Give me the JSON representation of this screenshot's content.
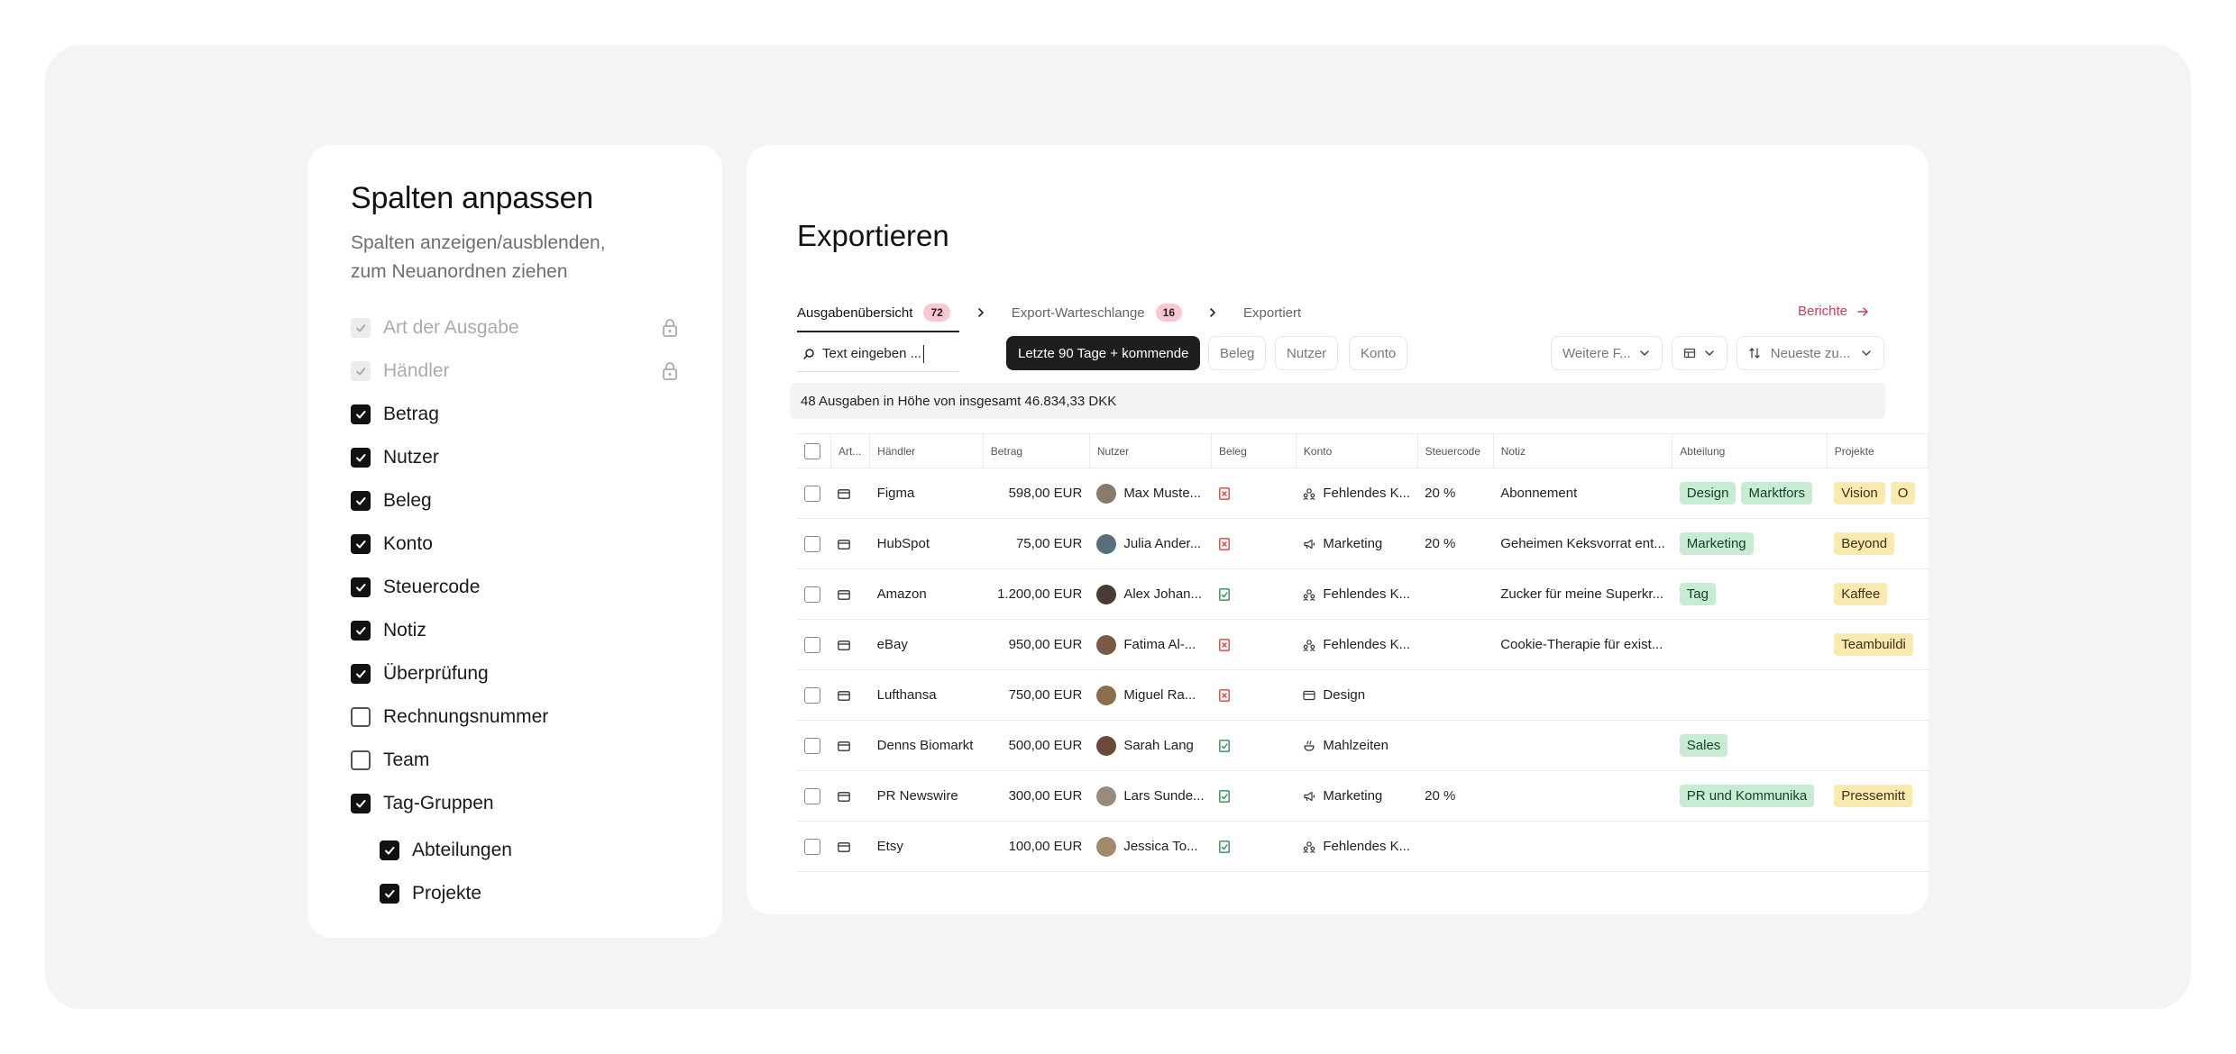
{
  "columns_panel": {
    "title": "Spalten anpassen",
    "subtitle": "Spalten anzeigen/ausblenden, zum Neuanordnen ziehen",
    "items": [
      {
        "label": "Art der Ausgabe",
        "state": "locked"
      },
      {
        "label": "Händler",
        "state": "locked"
      },
      {
        "label": "Betrag",
        "state": "checked"
      },
      {
        "label": "Nutzer",
        "state": "checked"
      },
      {
        "label": "Beleg",
        "state": "checked"
      },
      {
        "label": "Konto",
        "state": "checked"
      },
      {
        "label": "Steuercode",
        "state": "checked"
      },
      {
        "label": "Notiz",
        "state": "checked"
      },
      {
        "label": "Überprüfung",
        "state": "checked"
      },
      {
        "label": "Rechnungsnummer",
        "state": "unchecked"
      },
      {
        "label": "Team",
        "state": "unchecked"
      },
      {
        "label": "Tag-Gruppen",
        "state": "checked"
      }
    ],
    "subitems": [
      {
        "label": "Abteilungen",
        "state": "checked"
      },
      {
        "label": "Projekte",
        "state": "checked"
      }
    ]
  },
  "export": {
    "title": "Exportieren",
    "steps": [
      {
        "label": "Ausgabenübersicht",
        "count": "72"
      },
      {
        "label": "Export-Warteschlange",
        "count": "16"
      },
      {
        "label": "Exportiert"
      }
    ],
    "reports_link": "Berichte",
    "search_value": "Text eingeben ...",
    "filters": {
      "date": "Letzte 90 Tage + kommende",
      "beleg": "Beleg",
      "nutzer": "Nutzer",
      "konto": "Konto",
      "more": "Weitere F...",
      "sort": "Neueste zu..."
    },
    "summary": "48 Ausgaben in Höhe von insgesamt 46.834,33 DKK",
    "headers": {
      "art": "Art...",
      "haendler": "Händler",
      "betrag": "Betrag",
      "nutzer": "Nutzer",
      "beleg": "Beleg",
      "konto": "Konto",
      "steuercode": "Steuercode",
      "notiz": "Notiz",
      "abteilung": "Abteilung",
      "projekte": "Projekte"
    },
    "rows": [
      {
        "haendler": "Figma",
        "betrag": "598,00 EUR",
        "nutzer": "Max Muste...",
        "beleg": "missing",
        "konto_icon": "people-icon",
        "konto": "Fehlendes K...",
        "steuer": "20 %",
        "notiz": "Abonnement",
        "abteilung": [
          "Design",
          "Marktfors"
        ],
        "projekte": [
          "Vision",
          "O"
        ]
      },
      {
        "haendler": "HubSpot",
        "betrag": "75,00 EUR",
        "nutzer": "Julia Ander...",
        "beleg": "missing",
        "konto_icon": "megaphone-icon",
        "konto": "Marketing",
        "steuer": "20 %",
        "notiz": "Geheimen Keksvorrat ent...",
        "abteilung": [
          "Marketing"
        ],
        "projekte": [
          "Beyond"
        ]
      },
      {
        "haendler": "Amazon",
        "betrag": "1.200,00 EUR",
        "nutzer": "Alex Johan...",
        "beleg": "ok",
        "konto_icon": "people-icon",
        "konto": "Fehlendes K...",
        "steuer": "",
        "notiz": "Zucker für meine Superkr...",
        "abteilung": [
          "Tag"
        ],
        "projekte": [
          "Kaffee"
        ]
      },
      {
        "haendler": "eBay",
        "betrag": "950,00 EUR",
        "nutzer": "Fatima Al-...",
        "beleg": "missing",
        "konto_icon": "people-icon",
        "konto": "Fehlendes K...",
        "steuer": "",
        "notiz": "Cookie-Therapie für exist...",
        "abteilung": [],
        "projekte": [
          "Teambuildi"
        ]
      },
      {
        "haendler": "Lufthansa",
        "betrag": "750,00 EUR",
        "nutzer": "Miguel Ra...",
        "beleg": "missing",
        "konto_icon": "card-icon",
        "konto": "Design",
        "steuer": "",
        "notiz": "",
        "abteilung": [],
        "projekte": []
      },
      {
        "haendler": "Denns Biomarkt",
        "betrag": "500,00 EUR",
        "nutzer": "Sarah Lang",
        "beleg": "ok",
        "konto_icon": "food-icon",
        "konto": "Mahlzeiten",
        "steuer": "",
        "notiz": "",
        "abteilung": [
          "Sales"
        ],
        "projekte": []
      },
      {
        "haendler": "PR Newswire",
        "betrag": "300,00 EUR",
        "nutzer": "Lars Sunde...",
        "beleg": "ok",
        "konto_icon": "megaphone-icon",
        "konto": "Marketing",
        "steuer": "20 %",
        "notiz": "",
        "abteilung": [
          "PR und Kommunika"
        ],
        "projekte": [
          "Pressemitt"
        ]
      },
      {
        "haendler": "Etsy",
        "betrag": "100,00 EUR",
        "nutzer": "Jessica To...",
        "beleg": "ok",
        "konto_icon": "people-icon",
        "konto": "Fehlendes K...",
        "steuer": "",
        "notiz": "",
        "abteilung": [],
        "projekte": []
      }
    ],
    "colors": {
      "badge_bg": "#f8c8d2",
      "link": "#c2425a",
      "missing": "#d0443c",
      "ok": "#2e8b4e",
      "tag_green": "#c7ecd3",
      "tag_yellow": "#fbeab0"
    }
  }
}
